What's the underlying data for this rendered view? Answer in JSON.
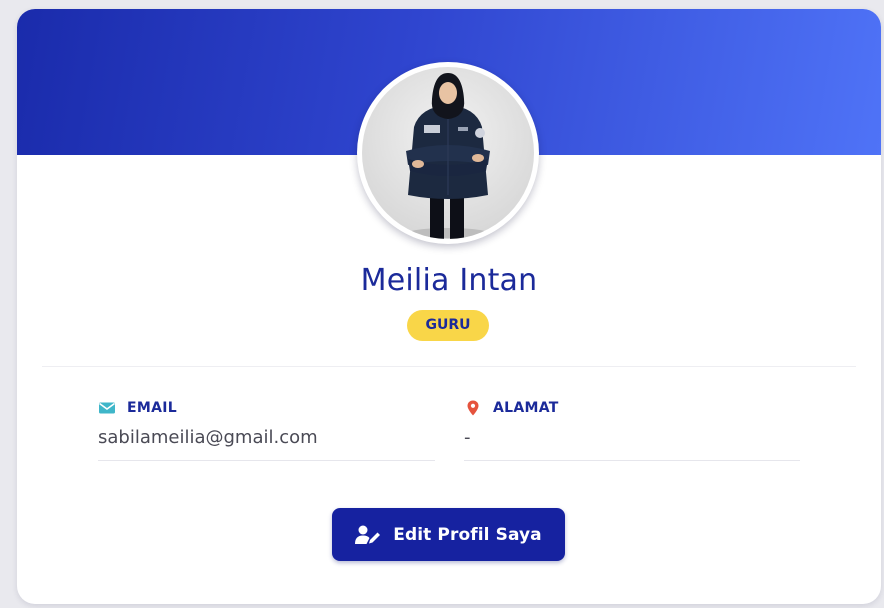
{
  "profile": {
    "name": "Meilia Intan",
    "role": "GURU"
  },
  "fields": {
    "email": {
      "label": "EMAIL",
      "value": "sabilameilia@gmail.com",
      "icon": "envelope-icon"
    },
    "alamat": {
      "label": "ALAMAT",
      "value": "-",
      "icon": "map-marker-icon"
    }
  },
  "actions": {
    "edit_profile_label": "Edit Profil Saya",
    "edit_profile_icon": "user-edit-icon"
  },
  "colors": {
    "primary": "#1b2a9a",
    "banner_start": "#1a2bab",
    "banner_end": "#4f73f7",
    "badge": "#f9d648",
    "email_icon": "#3fb6c9",
    "alamat_icon": "#e5533d",
    "button": "#1622a0"
  }
}
